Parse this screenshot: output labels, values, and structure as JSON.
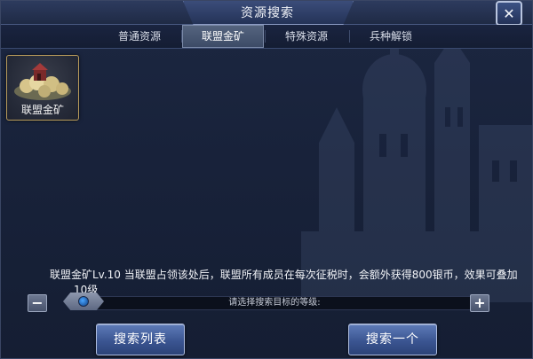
{
  "window": {
    "title": "资源搜索",
    "close_icon": "close-icon"
  },
  "tabs": [
    {
      "label": "普通资源",
      "active": false
    },
    {
      "label": "联盟金矿",
      "active": true
    },
    {
      "label": "特殊资源",
      "active": false
    },
    {
      "label": "兵种解锁",
      "active": false
    }
  ],
  "resource_card": {
    "label": "联盟金矿",
    "icon": "gold-mine-icon"
  },
  "description": "联盟金矿Lv.10 当联盟占领该处后，联盟所有成员在每次征税时，会额外获得800银币，效果可叠加",
  "level": {
    "label": "10级",
    "hint": "请选择搜索目标的等级:",
    "minus_icon": "minus-icon",
    "plus_icon": "plus-icon"
  },
  "buttons": {
    "search_list": "搜索列表",
    "search_one": "搜索一个"
  },
  "colors": {
    "accent": "#3b5592",
    "card_border": "#b79a5a",
    "slider_dot": "#4aa5ff"
  }
}
